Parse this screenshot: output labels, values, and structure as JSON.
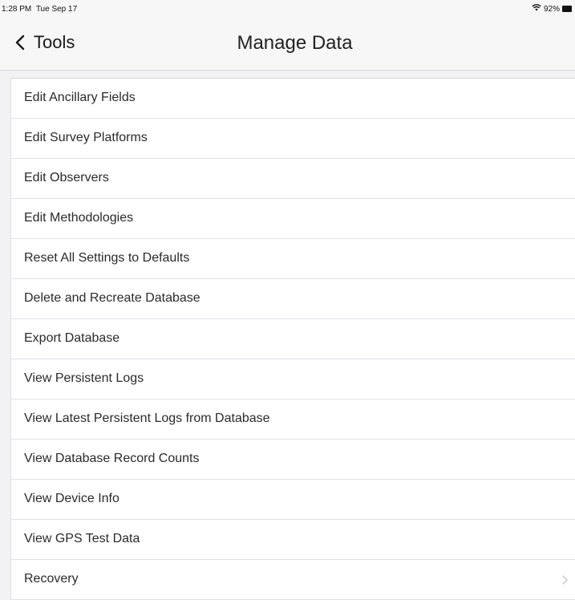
{
  "status_bar": {
    "time": "1:28 PM",
    "date": "Tue Sep 17",
    "battery_percent": "92%",
    "icons": [
      "wifi-icon",
      "battery-icon"
    ]
  },
  "nav": {
    "back_label": "Tools",
    "title": "Manage Data",
    "back_icon": "chevron-left-icon"
  },
  "menu": {
    "items": [
      {
        "label": "Edit Ancillary Fields"
      },
      {
        "label": "Edit Survey Platforms"
      },
      {
        "label": "Edit Observers"
      },
      {
        "label": "Edit Methodologies"
      },
      {
        "label": "Reset All Settings to Defaults"
      },
      {
        "label": "Delete and Recreate Database"
      },
      {
        "label": "Export Database"
      },
      {
        "label": "View Persistent Logs"
      },
      {
        "label": "View Latest Persistent Logs from Database"
      },
      {
        "label": "View Database Record Counts"
      },
      {
        "label": "View Device Info"
      },
      {
        "label": "View GPS Test Data"
      },
      {
        "label": "Recovery",
        "disclosure_icon": "chevron-right-icon"
      }
    ]
  }
}
